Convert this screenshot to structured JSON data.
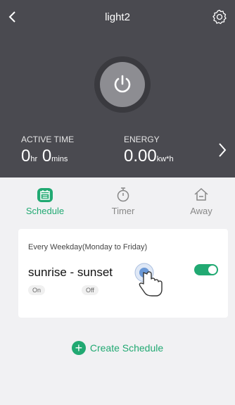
{
  "header": {
    "title": "light2"
  },
  "stats": {
    "active_time_label": "ACTIVE TIME",
    "hours": "0",
    "hr_unit": "hr",
    "mins": "0",
    "mins_unit": "mins",
    "energy_label": "ENERGY",
    "energy_value": "0.00",
    "energy_unit": "kw*h"
  },
  "tabs": [
    {
      "label": "Schedule",
      "icon": "calendar-icon",
      "active": true
    },
    {
      "label": "Timer",
      "icon": "stopwatch-icon",
      "active": false
    },
    {
      "label": "Away",
      "icon": "house-icon",
      "active": false
    }
  ],
  "schedule": {
    "recurrence": "Every Weekday(Monday to Friday)",
    "name": "sunrise - sunset",
    "on_label": "On",
    "off_label": "Off",
    "enabled": true
  },
  "create": {
    "label": "Create Schedule"
  },
  "colors": {
    "accent": "#21a972",
    "header_bg": "#4a4a50",
    "page_bg": "#f1f1f3"
  }
}
